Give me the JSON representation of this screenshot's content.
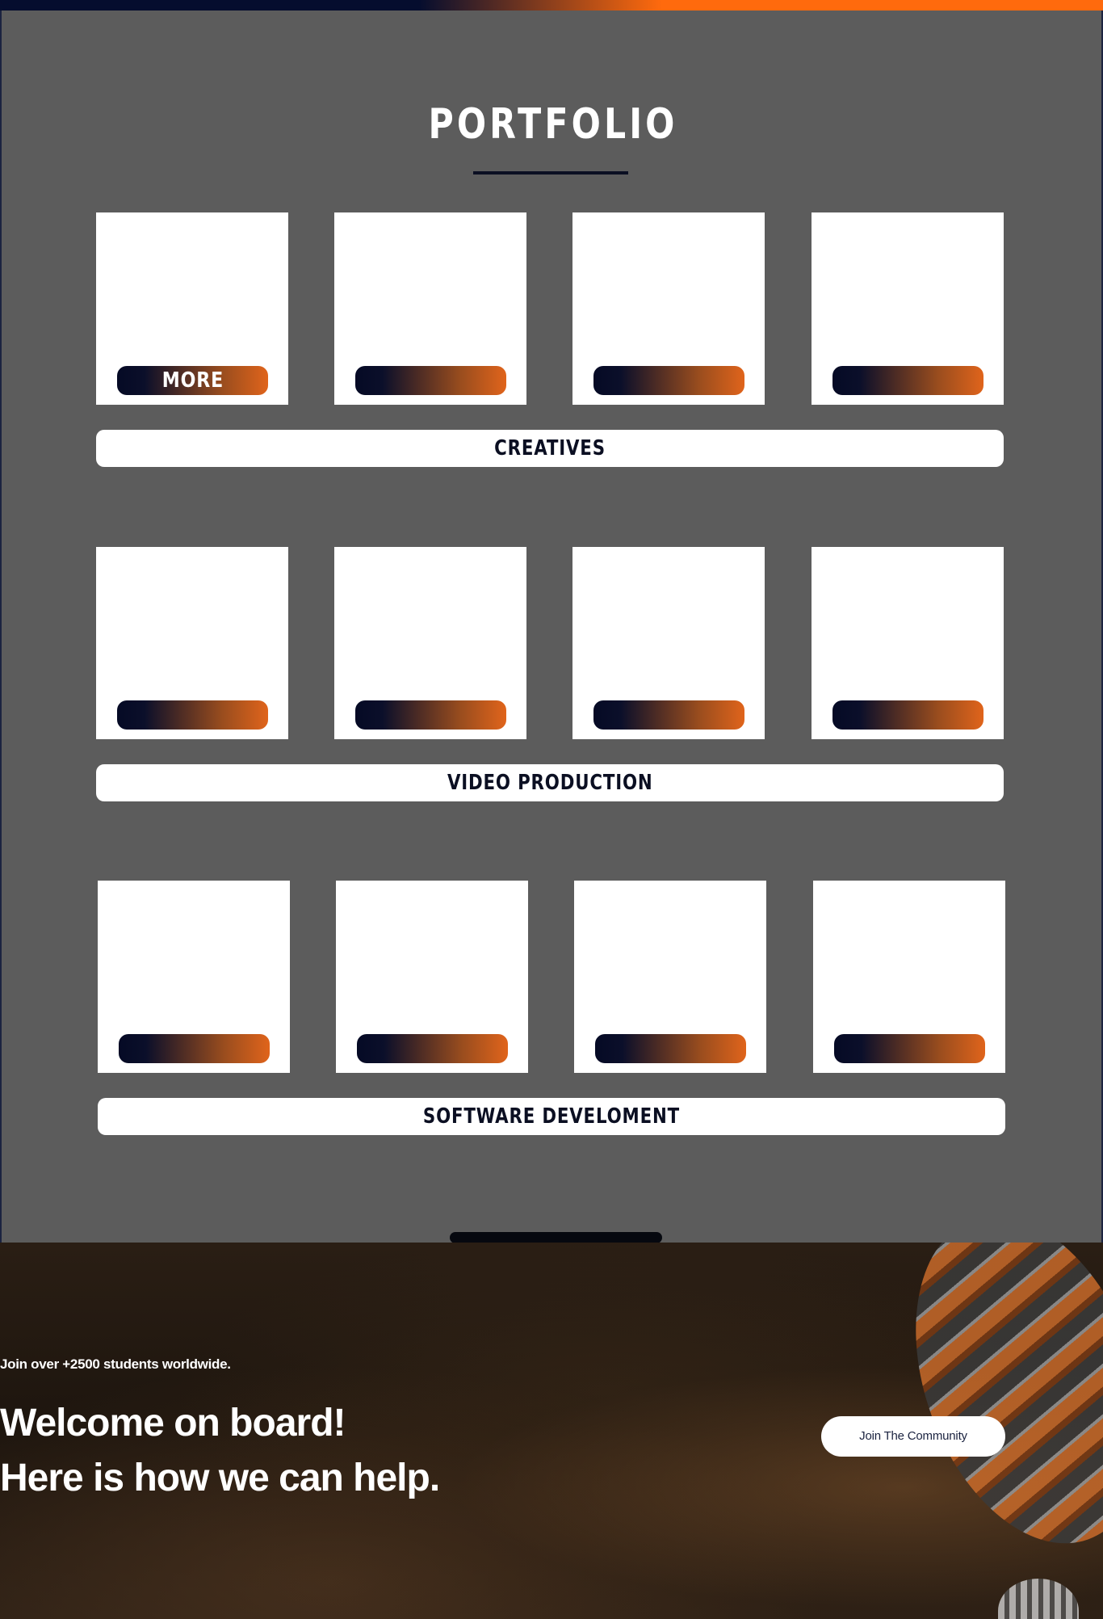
{
  "portfolio": {
    "title": "PORTFOLIO",
    "more_label": "MORE",
    "categories": [
      {
        "label": "CREATIVES"
      },
      {
        "label": "VIDEO PRODUCTION"
      },
      {
        "label": "SOFTWARE  DEVELOMENT"
      }
    ]
  },
  "hero": {
    "tagline": "Join over +2500 students worldwide.",
    "heading_line1": "Welcome on board!",
    "heading_line2": "Here is how we can help.",
    "cta_label": "Join The Community"
  },
  "colors": {
    "accent_orange": "#ff6a0d",
    "navy": "#050d2e",
    "panel_gray": "#5c5c5c"
  }
}
